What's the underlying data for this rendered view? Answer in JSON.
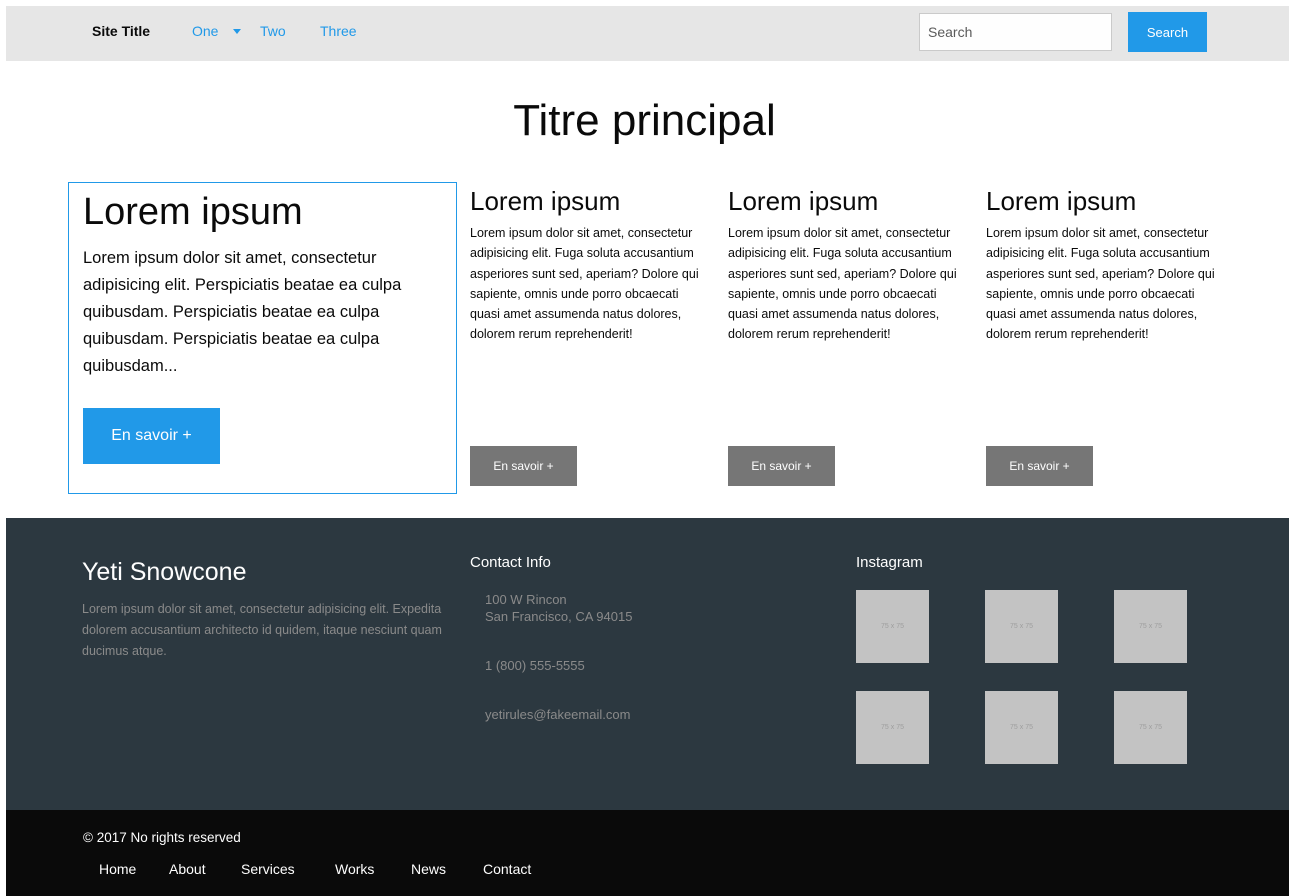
{
  "topbar": {
    "site_title": "Site Title",
    "nav": [
      {
        "label": "One",
        "has_dropdown": true
      },
      {
        "label": "Two"
      },
      {
        "label": "Three"
      }
    ],
    "search_placeholder": "Search",
    "search_button": "Search"
  },
  "main": {
    "title": "Titre principal",
    "featured_card": {
      "heading": "Lorem ipsum",
      "text": "Lorem ipsum dolor sit amet, consectetur adipisicing elit. Perspiciatis beatae ea culpa quibusdam. Perspiciatis beatae ea culpa quibusdam. Perspiciatis beatae ea culpa quibusdam...",
      "button": "En savoir +"
    },
    "cards": [
      {
        "heading": "Lorem ipsum",
        "text": "Lorem ipsum dolor sit amet, consectetur adipisicing elit. Fuga soluta accusantium asperiores sunt sed, aperiam? Dolore qui sapiente, omnis unde porro obcaecati quasi amet assumenda natus dolores, dolorem rerum reprehenderit!",
        "button": "En savoir +"
      },
      {
        "heading": "Lorem ipsum",
        "text": "Lorem ipsum dolor sit amet, consectetur adipisicing elit. Fuga soluta accusantium asperiores sunt sed, aperiam? Dolore qui sapiente, omnis unde porro obcaecati quasi amet assumenda natus dolores, dolorem rerum reprehenderit!",
        "button": "En savoir +"
      },
      {
        "heading": "Lorem ipsum",
        "text": "Lorem ipsum dolor sit amet, consectetur adipisicing elit. Fuga soluta accusantium asperiores sunt sed, aperiam? Dolore qui sapiente, omnis unde porro obcaecati quasi amet assumenda natus dolores, dolorem rerum reprehenderit!",
        "button": "En savoir +"
      }
    ]
  },
  "footer": {
    "brand": "Yeti Snowcone",
    "description": "Lorem ipsum dolor sit amet, consectetur adipisicing elit. Expedita dolorem accusantium architecto id quidem, itaque nesciunt quam ducimus atque.",
    "contact_heading": "Contact Info",
    "address_line1": "100 W Rincon",
    "address_line2": "San Francisco, CA 94015",
    "phone": "1 (800) 555-5555",
    "email": "yetirules@fakeemail.com",
    "instagram_heading": "Instagram",
    "thumbnails": [
      "75 x 75",
      "75 x 75",
      "75 x 75",
      "75 x 75",
      "75 x 75",
      "75 x 75"
    ]
  },
  "bottombar": {
    "copyright": "© 2017 No rights reserved",
    "links": [
      "Home",
      "About",
      "Services",
      "Works",
      "News",
      "Contact"
    ]
  },
  "colors": {
    "primary": "#2199e8",
    "secondary": "#767676",
    "footer_bg": "#2c3840",
    "bottom_bg": "#0a0a0a",
    "topbar_bg": "#e6e6e6"
  }
}
